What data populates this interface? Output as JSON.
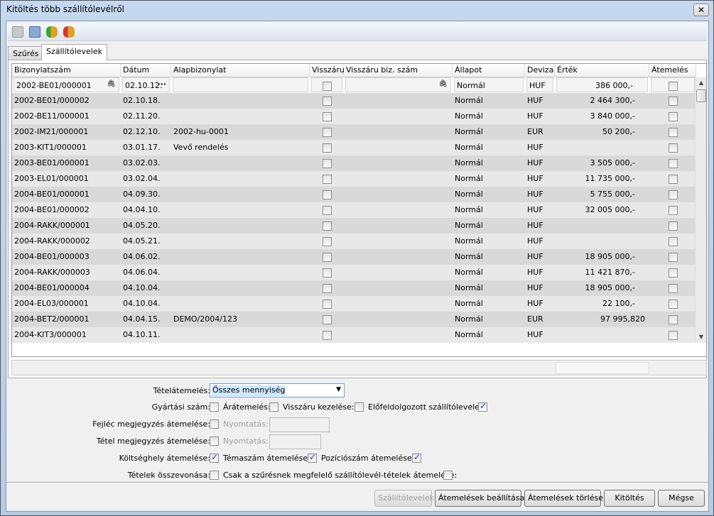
{
  "window": {
    "title": "Kitöltés több szállítólevélről",
    "close": "✕"
  },
  "toolbar": {
    "icons": [
      "print-preview-icon",
      "calculator-icon",
      "database-green-arrow-icon",
      "database-red-arrow-icon"
    ]
  },
  "tabs": [
    {
      "label": "Szűrés"
    },
    {
      "label": "Szállítólevelek",
      "active": true
    }
  ],
  "grid": {
    "columns": [
      "Bizonylatszám",
      "Dátum",
      "Alapbizonylat",
      "Visszáru",
      "Visszáru biz. szám",
      "Állapot",
      "Deviza",
      "Érték",
      "Átemelés"
    ],
    "rows": [
      [
        "2002-BE01/000001",
        "02.10.12.",
        "",
        false,
        "",
        "Normál",
        "HUF",
        "386 000,-",
        false
      ],
      [
        "2002-BE01/000002",
        "02.10.18.",
        "",
        false,
        "",
        "Normál",
        "HUF",
        "2 464 300,-",
        false
      ],
      [
        "2002-BE11/000001",
        "02.11.20.",
        "",
        false,
        "",
        "Normál",
        "HUF",
        "3 840 000,-",
        false
      ],
      [
        "2002-IM21/000001",
        "02.12.10.",
        "2002-hu-0001",
        false,
        "",
        "Normál",
        "EUR",
        "50 200,-",
        false
      ],
      [
        "2003-KIT1/000001",
        "03.01.17.",
        "Vevő rendelés",
        false,
        "",
        "Normál",
        "HUF",
        "",
        false
      ],
      [
        "2003-BE01/000001",
        "03.02.03.",
        "",
        false,
        "",
        "Normál",
        "HUF",
        "3 505 000,-",
        false
      ],
      [
        "2003-EL01/000001",
        "03.02.04.",
        "",
        false,
        "",
        "Normál",
        "HUF",
        "11 735 000,-",
        false
      ],
      [
        "2004-BE01/000001",
        "04.09.30.",
        "",
        false,
        "",
        "Normál",
        "HUF",
        "5 755 000,-",
        false
      ],
      [
        "2004-BE01/000002",
        "04.04.10.",
        "",
        false,
        "",
        "Normál",
        "HUF",
        "32 005 000,-",
        false
      ],
      [
        "2004-RAKK/000001",
        "04.05.20.",
        "",
        false,
        "",
        "Normál",
        "HUF",
        "",
        false
      ],
      [
        "2004-RAKK/000002",
        "04.05.21.",
        "",
        false,
        "",
        "Normál",
        "HUF",
        "",
        false
      ],
      [
        "2004-BE01/000003",
        "04.06.02.",
        "",
        false,
        "",
        "Normál",
        "HUF",
        "18 905 000,-",
        false
      ],
      [
        "2004-RAKK/000003",
        "04.06.04.",
        "",
        false,
        "",
        "Normál",
        "HUF",
        "11 421 870,-",
        false
      ],
      [
        "2004-BE01/000004",
        "04.10.04.",
        "",
        false,
        "",
        "Normál",
        "HUF",
        "18 905 000,-",
        false
      ],
      [
        "2004-EL03/000001",
        "04.10.04.",
        "",
        false,
        "",
        "Normál",
        "HUF",
        "22 100,-",
        false
      ],
      [
        "2004-BET2/000001",
        "04.04.15.",
        "DEMO/2004/123",
        false,
        "",
        "Normál",
        "EUR",
        "97 995,820",
        false
      ],
      [
        "2004-KIT3/000001",
        "04.10.11.",
        "",
        false,
        "",
        "Normál",
        "HUF",
        "",
        false
      ]
    ]
  },
  "options": {
    "tetelatemeles_label": "Tételátemelés:",
    "tetelatemeles_value": "Összes mennyiség",
    "gyartasi_label": "Gyártási szám:",
    "gyartasi": false,
    "aratemeles_label": "Árátemelés:",
    "aratemeles": false,
    "visszaru_label": "Visszáru kezelése:",
    "visszaru": false,
    "elofeldolgozott_label": "Előfeldolgozott szállítólevelek:",
    "elofeldolgozott": true,
    "fejlec_label": "Fejléc megjegyzés átemelése:",
    "fejlec": false,
    "nyomtatas_label": "Nyomtatás:",
    "tetel_megj_label": "Tétel megjegyzés átemelése:",
    "tetel_megj": false,
    "koltseghely_label": "Költséghely átemelése:",
    "koltseghely": true,
    "temaszam_label": "Témaszám átemelése:",
    "temaszam": true,
    "pozicio_label": "Pozíciószám átemelése:",
    "pozicio": true,
    "osszevonas_label": "Tételek összevonása:",
    "osszevonas": false,
    "csak_label": "Csak a szűrésnek megfelelő szállítólevél-tételek átemelése:",
    "csak": false
  },
  "buttons": {
    "szallitolevelek": "Szállítólevelek",
    "beallitasa": "Átemelések beállítása",
    "torlese": "Átemelések törlése",
    "kitoltes": "Kitöltés",
    "megse": "Mégse"
  }
}
